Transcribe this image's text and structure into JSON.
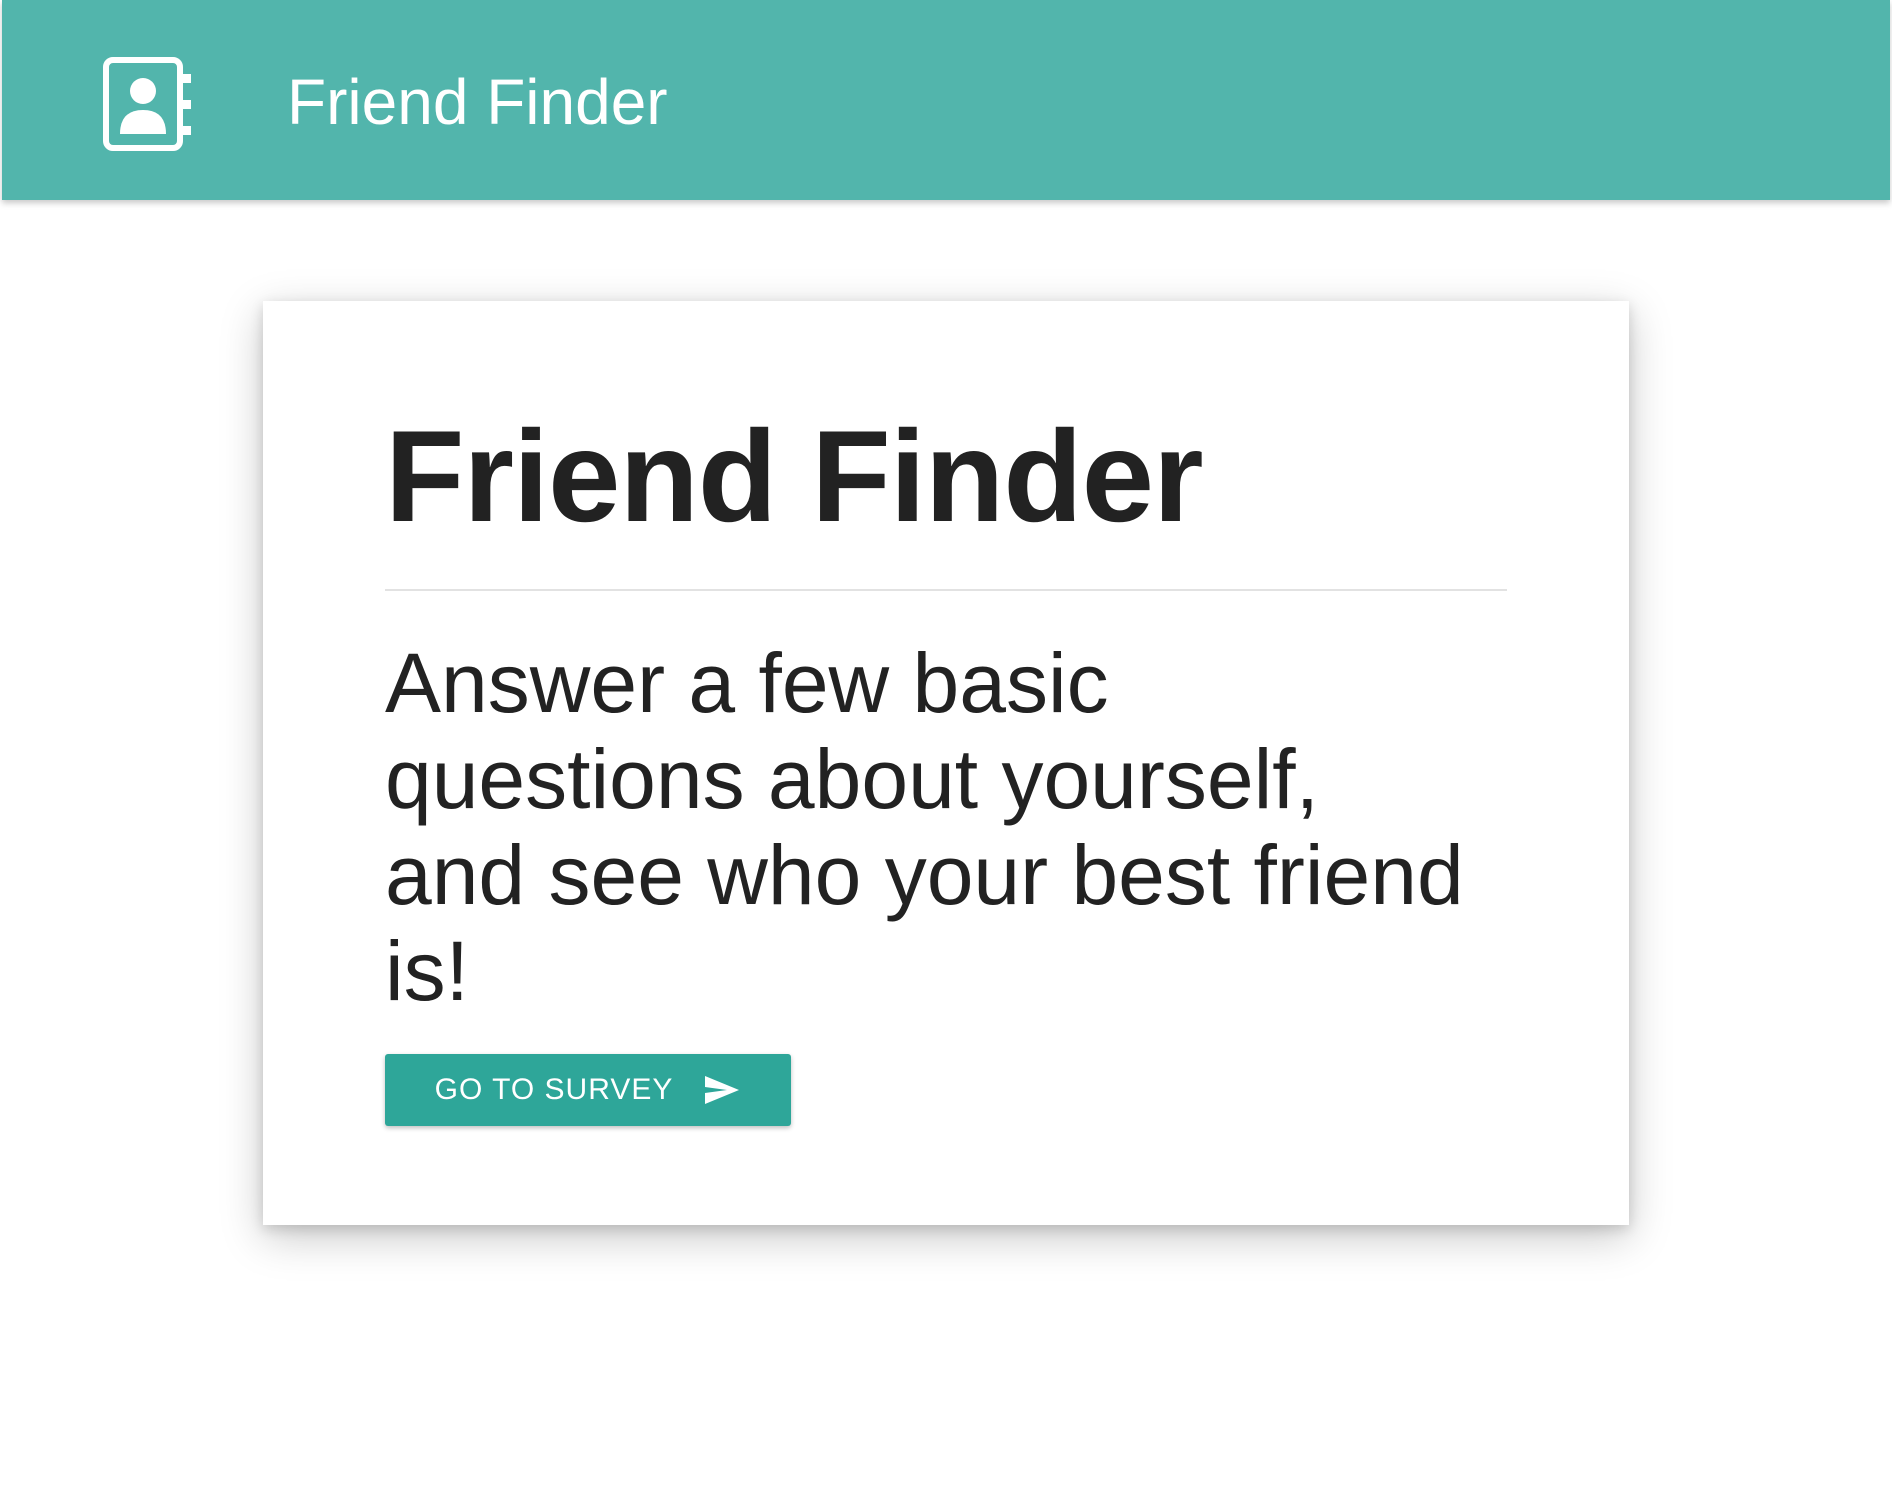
{
  "navbar": {
    "brand_title": "Friend Finder",
    "icon": "contact-book-icon",
    "background_color": "#52b5ac"
  },
  "card": {
    "title": "Friend Finder",
    "lead": "Answer a few basic questions about yourself, and see who your best friend is!",
    "button": {
      "label": "GO TO SURVEY",
      "icon": "send-icon",
      "background_color": "#2ea699"
    }
  }
}
